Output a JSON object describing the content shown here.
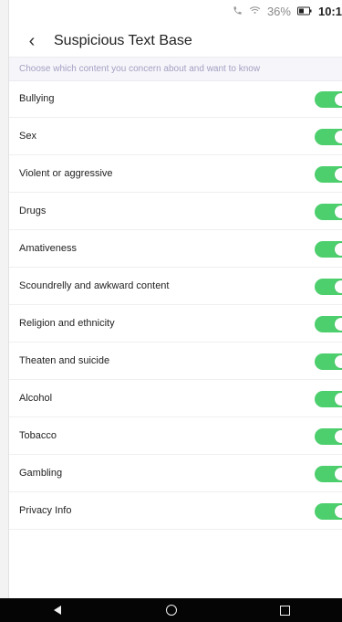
{
  "status_bar": {
    "phone_icon": "phone-icon",
    "wifi_icon": "wifi-icon",
    "battery_percent": "36%",
    "battery_icon": "battery-icon",
    "time": "10:1"
  },
  "header": {
    "back_symbol": "‹",
    "title": "Suspicious Text Base"
  },
  "description": "Choose which content you concern about and want to know",
  "toggle_color": "#4ccf6c",
  "items": [
    {
      "label": "Bullying",
      "enabled": true
    },
    {
      "label": "Sex",
      "enabled": true
    },
    {
      "label": "Violent or aggressive",
      "enabled": true
    },
    {
      "label": "Drugs",
      "enabled": true
    },
    {
      "label": "Amativeness",
      "enabled": true
    },
    {
      "label": "Scoundrelly and awkward content",
      "enabled": true
    },
    {
      "label": "Religion and ethnicity",
      "enabled": true
    },
    {
      "label": "Theaten and suicide",
      "enabled": true
    },
    {
      "label": "Alcohol",
      "enabled": true
    },
    {
      "label": "Tobacco",
      "enabled": true
    },
    {
      "label": "Gambling",
      "enabled": true
    },
    {
      "label": "Privacy Info",
      "enabled": true
    }
  ],
  "nav_bar": {
    "back": "back-nav-icon",
    "home": "home-nav-icon",
    "recent": "recent-apps-icon"
  }
}
